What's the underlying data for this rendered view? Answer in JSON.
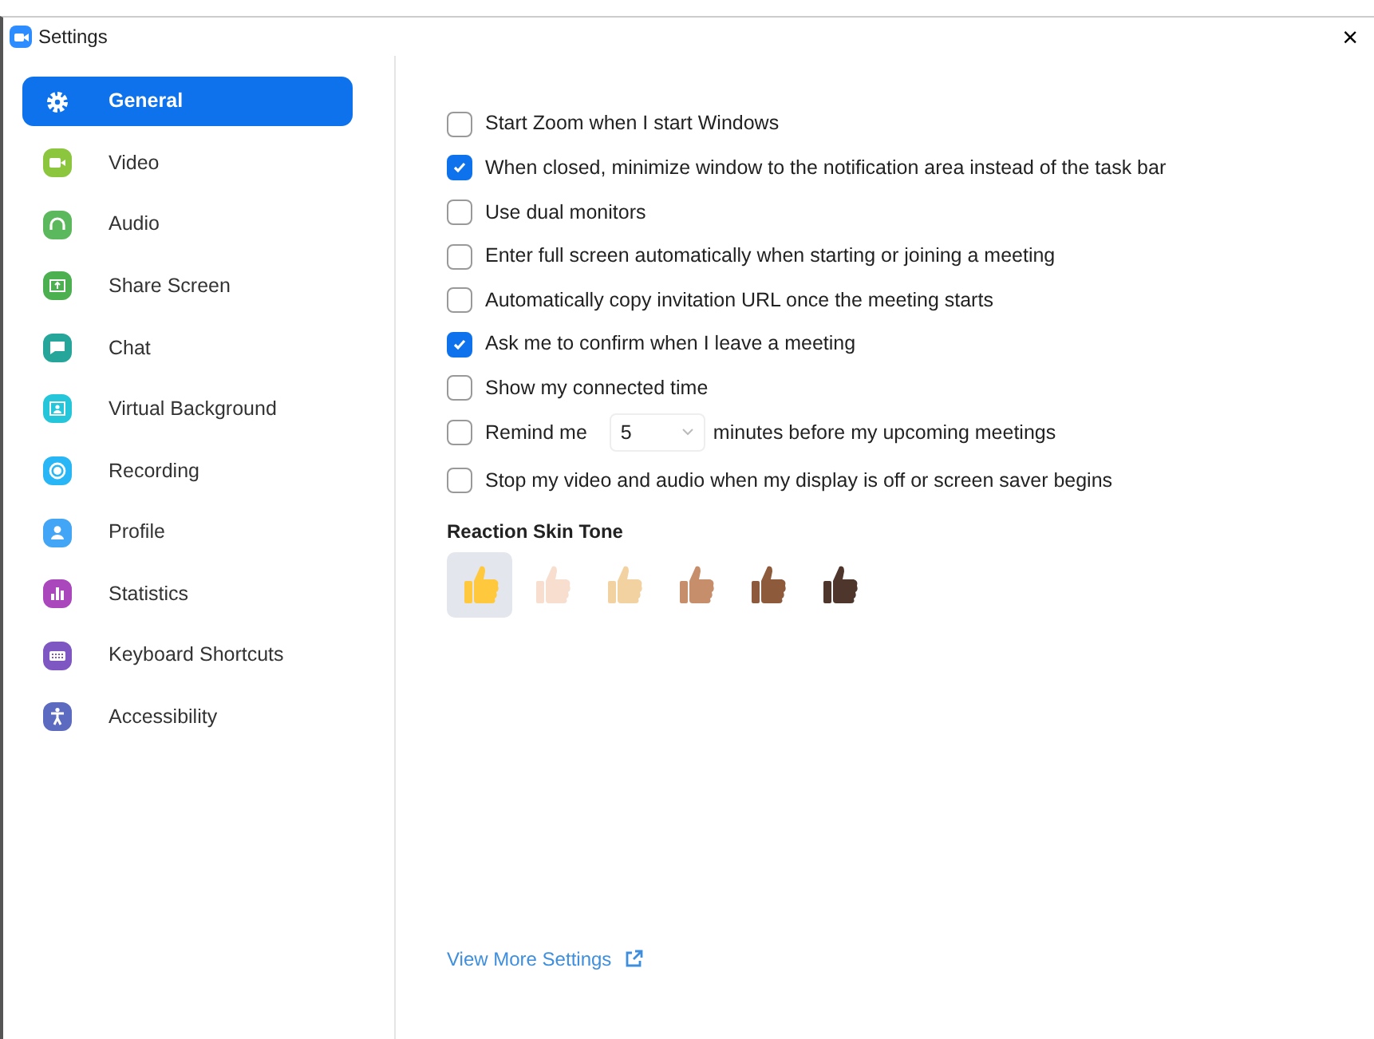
{
  "window": {
    "title": "Settings",
    "close": "×"
  },
  "sidebar": {
    "items": [
      {
        "label": "General",
        "selected": true,
        "color": "#0e72ed"
      },
      {
        "label": "Video",
        "selected": false,
        "color": "#8cc63f"
      },
      {
        "label": "Audio",
        "selected": false,
        "color": "#5cb85c"
      },
      {
        "label": "Share Screen",
        "selected": false,
        "color": "#4caf50"
      },
      {
        "label": "Chat",
        "selected": false,
        "color": "#26a69a"
      },
      {
        "label": "Virtual Background",
        "selected": false,
        "color": "#26c6da"
      },
      {
        "label": "Recording",
        "selected": false,
        "color": "#29b6f6"
      },
      {
        "label": "Profile",
        "selected": false,
        "color": "#42a5f5"
      },
      {
        "label": "Statistics",
        "selected": false,
        "color": "#ab47bc"
      },
      {
        "label": "Keyboard Shortcuts",
        "selected": false,
        "color": "#7e57c2"
      },
      {
        "label": "Accessibility",
        "selected": false,
        "color": "#5c6bc0"
      }
    ]
  },
  "options": [
    {
      "kind": "checkbox",
      "label": "Start Zoom when I start Windows",
      "checked": false
    },
    {
      "kind": "checkbox",
      "label": "When closed, minimize window to the notification area instead of the task bar",
      "checked": true
    },
    {
      "kind": "checkbox",
      "label": "Use dual monitors",
      "checked": false
    },
    {
      "kind": "checkbox",
      "label": "Enter full screen automatically when starting or joining a meeting",
      "checked": false
    },
    {
      "kind": "checkbox",
      "label": "Automatically copy invitation URL once the meeting starts",
      "checked": false
    },
    {
      "kind": "checkbox",
      "label": "Ask me to confirm when I leave a meeting",
      "checked": true
    },
    {
      "kind": "checkbox",
      "label": "Show my connected time",
      "checked": false
    },
    {
      "kind": "reminder",
      "label": "Remind me",
      "checked": false,
      "value": "5",
      "suffix": "minutes before my upcoming meetings"
    },
    {
      "kind": "checkbox",
      "label": "Stop my video and audio when my display is off or screen saver begins",
      "checked": false
    }
  ],
  "skin_tone": {
    "heading": "Reaction Skin Tone",
    "tones": [
      {
        "selected": true,
        "color": "#ffc83d"
      },
      {
        "selected": false,
        "color": "#f7dece"
      },
      {
        "selected": false,
        "color": "#f3d2a2"
      },
      {
        "selected": false,
        "color": "#c68e6a"
      },
      {
        "selected": false,
        "color": "#8d5a3b"
      },
      {
        "selected": false,
        "color": "#4e362c"
      }
    ]
  },
  "footer_link": "View More Settings"
}
